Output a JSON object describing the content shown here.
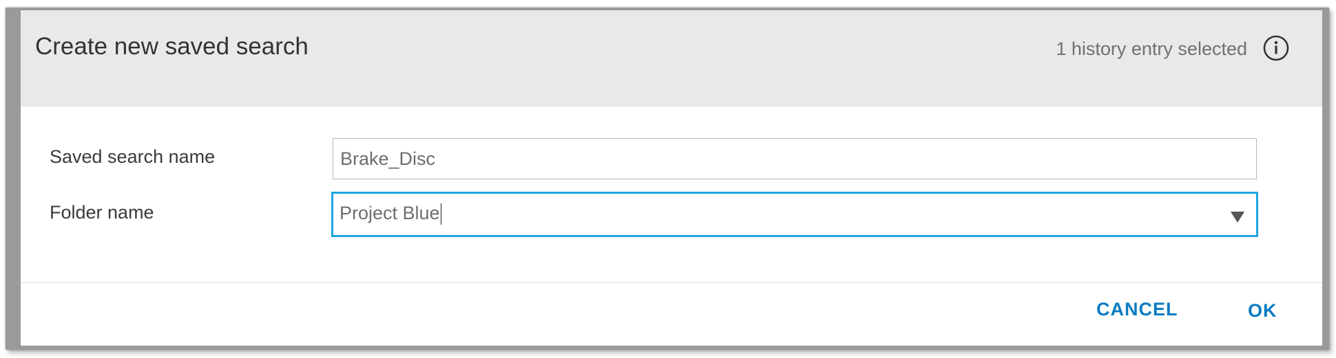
{
  "dialog": {
    "title": "Create new saved search",
    "history_status": "1 history entry selected",
    "info_icon": "info-icon"
  },
  "form": {
    "saved_search_name_label": "Saved search name",
    "saved_search_name_value": "Brake_Disc",
    "folder_name_label": "Folder name",
    "folder_name_value": "Project Blue"
  },
  "footer": {
    "cancel_label": "CANCEL",
    "ok_label": "OK"
  },
  "colors": {
    "accent": "#0a7bc1",
    "focus_border": "#1ba6df",
    "header_bg": "#e8e9e8"
  }
}
